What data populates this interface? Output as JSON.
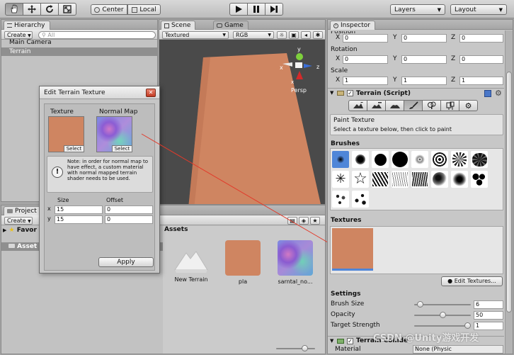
{
  "toolbar": {
    "pivot_label": "Center",
    "space_label": "Local",
    "layers_label": "Layers",
    "layout_label": "Layout",
    "transform_tools": [
      "hand-icon",
      "move-icon",
      "rotate-icon",
      "scale-icon"
    ]
  },
  "hierarchy": {
    "tab_label": "Hierarchy",
    "create_label": "Create",
    "search_placeholder": "All",
    "items": [
      {
        "label": "Main Camera",
        "selected": false
      },
      {
        "label": "Terrain",
        "selected": true
      }
    ]
  },
  "scene": {
    "tab_scene": "Scene",
    "tab_game": "Game",
    "render_mode": "Textured",
    "color_mode": "RGB",
    "persp_label": "Persp",
    "gizmo_axes": {
      "y": "y",
      "x": "x",
      "z": "z"
    },
    "terrain_color": "#cf8561"
  },
  "project": {
    "tab_label": "Project",
    "create_label": "Create",
    "favorites_label": "Favor",
    "assets_tree_label": "Asset",
    "assets_header": "Assets",
    "items": [
      {
        "label": "New Terrain",
        "kind": "terrain"
      },
      {
        "label": "pla",
        "kind": "texture"
      },
      {
        "label": "sarntal_no...",
        "kind": "normal"
      }
    ]
  },
  "dialog": {
    "title": "Edit Terrain Texture",
    "texture_label": "Texture",
    "normal_map_label": "Normal Map",
    "select_label": "Select",
    "note": "Note: in order for normal map to have effect, a custom material with normal mapped terrain shader needs to be used.",
    "size_label": "Size",
    "offset_label": "Offset",
    "size_x": "15",
    "size_y": "15",
    "offset_x": "0",
    "offset_y": "0",
    "axis_x": "x",
    "axis_y": "y",
    "apply_label": "Apply"
  },
  "inspector": {
    "tab_label": "Inspector",
    "position_label": "Position",
    "rotation_label": "Rotation",
    "scale_label": "Scale",
    "axis_x": "X",
    "axis_y": "Y",
    "axis_z": "Z",
    "position": {
      "x": "0",
      "y": "0",
      "z": "0"
    },
    "rotation": {
      "x": "0",
      "y": "0",
      "z": "0"
    },
    "scale": {
      "x": "1",
      "y": "1",
      "z": "1"
    },
    "component_title": "Terrain (Script)",
    "paint_texture_title": "Paint Texture",
    "paint_texture_hint": "Select a texture below, then click to paint",
    "brushes_label": "Brushes",
    "textures_label": "Textures",
    "edit_textures_label": "Edit Textures...",
    "settings_label": "Settings",
    "brush_size_label": "Brush Size",
    "brush_size_value": "6",
    "brush_size_fraction": 0.06,
    "opacity_label": "Opacity",
    "opacity_value": "50",
    "opacity_fraction": 0.5,
    "target_strength_label": "Target Strength",
    "target_strength_value": "1",
    "target_strength_fraction": 1.0,
    "collider_label": "Terrain Collide",
    "material_label": "Material",
    "material_value": "None (Physic",
    "watermark": "CSDN @Unity游戏开发"
  },
  "colors": {
    "terrain": "#cf8561",
    "selection": "#4f86d8",
    "panel": "#c2c2c2",
    "scene_bg": "#4a4a4a"
  }
}
